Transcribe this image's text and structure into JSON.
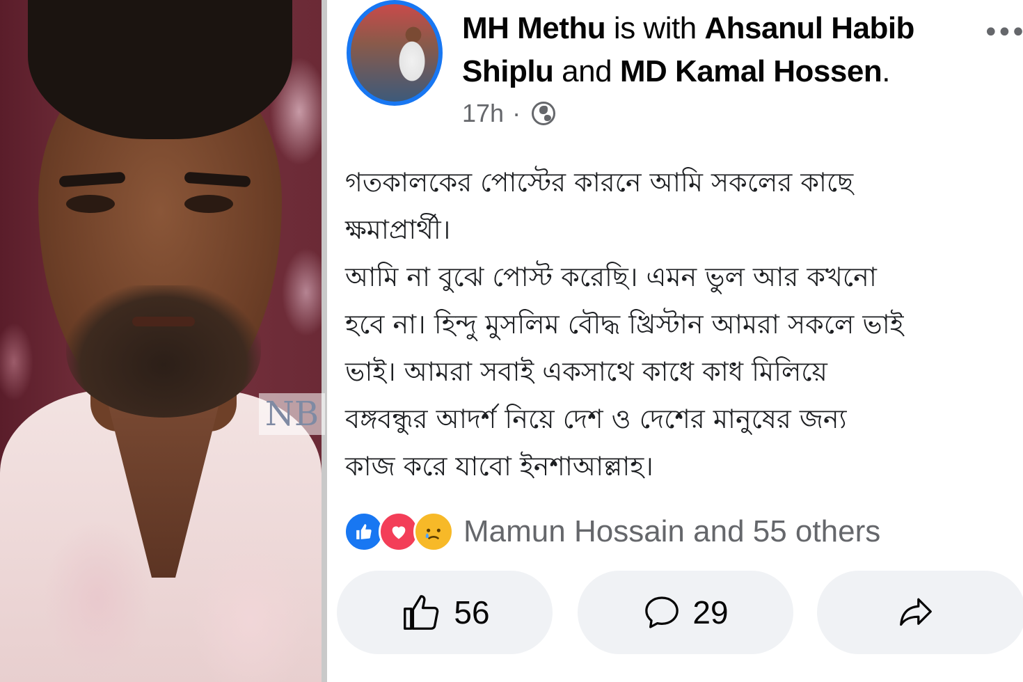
{
  "photo": {
    "watermark": "NB"
  },
  "post": {
    "author": {
      "name": "MH Methu",
      "with_text": "is with",
      "tagged_1": "Ahsanul Habib Shiplu",
      "and_text": "and",
      "tagged_2": "MD Kamal Hossen",
      "period": "."
    },
    "timestamp": "17h",
    "separator": "·",
    "privacy_icon": "globe-icon",
    "more_icon": "more-options-icon",
    "more_glyph": "•••",
    "body_lines": [
      "গতকালকের পোস্টের কারনে আমি সকলের কাছে",
      "ক্ষমাপ্রার্থী।",
      "আমি না বুঝে পোস্ট করেছি। এমন ভুল আর কখনো",
      "হবে না। হিন্দু মুসলিম বৌদ্ধ খ্রিস্টান আমরা সকলে ভাই",
      "ভাই। আমরা সবাই একসাথে কাধে কাধ মিলিয়ে",
      "বঙ্গবন্ধুর আদর্শ নিয়ে দেশ ও দেশের মানুষের জন্য",
      "কাজ করে যাবো ইনশাআল্লাহ।"
    ],
    "reactions": {
      "icons": [
        "like-reaction-icon",
        "love-reaction-icon",
        "sad-reaction-icon"
      ],
      "summary": "Mamun Hossain and 55 others"
    },
    "actions": {
      "like_count": "56",
      "comment_count": "29",
      "share_icon": "share-icon"
    },
    "colors": {
      "facebook_blue": "#1877f2",
      "love_red": "#f33e58",
      "sad_yellow": "#f7b928",
      "secondary_text": "#65676b",
      "button_bg": "#f0f2f5"
    }
  }
}
